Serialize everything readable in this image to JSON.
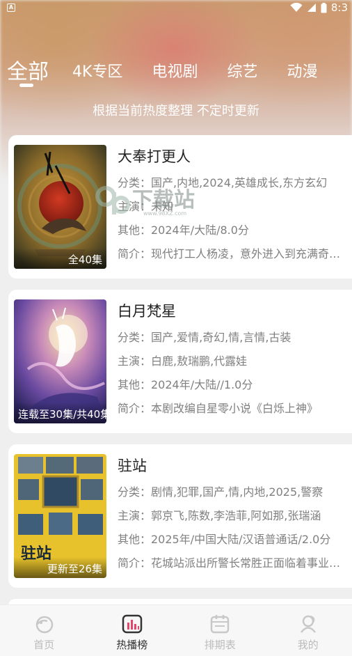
{
  "status_bar": {
    "time": "8:3",
    "notification_icon": "A"
  },
  "tabs": [
    {
      "label": "全部",
      "active": true
    },
    {
      "label": "4K专区",
      "active": false
    },
    {
      "label": "电视剧",
      "active": false
    },
    {
      "label": "综艺",
      "active": false
    },
    {
      "label": "动漫",
      "active": false
    }
  ],
  "subtitle": "根据当前热度整理 不定时更新",
  "items": [
    {
      "title": "大奉打更人",
      "badge": "全40集",
      "category": "分类：国产,内地,2024,英雄成长,东方玄幻",
      "cast": "主演：未知",
      "other": "其他：2024年/大陆/8.0分",
      "intro": "简介：现代打工人杨凌，意外进入到充满奇幻色彩的世界"
    },
    {
      "title": "白月梵星",
      "badge": "连载至30集/共40集",
      "category": "分类：国产,爱情,奇幻,情,言情,古装",
      "cast": "主演：白鹿,敖瑞鹏,代露娃",
      "other": "其他：2024年/大陆//1.0分",
      "intro": "简介：本剧改编自星零小说《白烁上神》"
    },
    {
      "title": "驻站",
      "badge": "更新至26集",
      "category": "分类：剧情,犯罪,国产,情,内地,2025,警察",
      "cast": "主演：郭京飞,陈数,李浩菲,阿如那,张瑞涵",
      "other": "其他：2025年/中国大陆/汉语普通话/2.0分",
      "intro": "简介：花城站派出所警长常胜正面临着事业危机"
    }
  ],
  "watermark": {
    "text": "下载站",
    "url": "www.98XZ.com"
  },
  "bottom_nav": [
    {
      "label": "首页",
      "icon": "home-icon",
      "active": false
    },
    {
      "label": "热播榜",
      "icon": "chart-icon",
      "active": true
    },
    {
      "label": "排期表",
      "icon": "calendar-icon",
      "active": false
    },
    {
      "label": "我的",
      "icon": "profile-icon",
      "active": false
    }
  ],
  "colors": {
    "accent": "#e0476b",
    "text_gray": "#808080",
    "title": "#222222"
  }
}
